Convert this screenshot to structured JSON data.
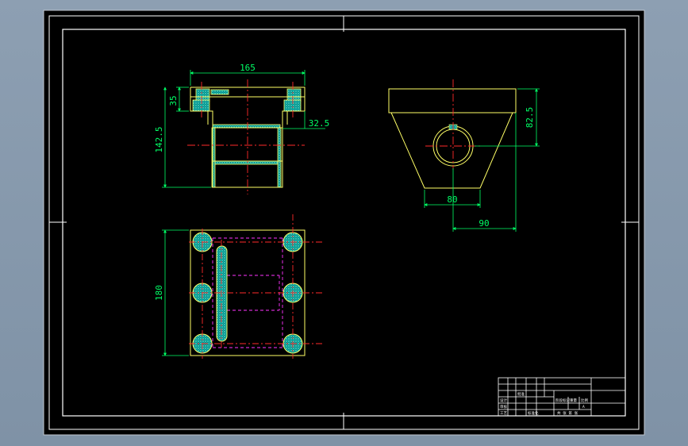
{
  "colors": {
    "background": "#8b9db0",
    "canvas": "#000000",
    "frame": "#ffffff",
    "outline": "#ffff66",
    "dimension": "#00ff66",
    "centerline": "#ff2a2a",
    "hidden_line": "#ff33ff",
    "hatch": "#00a8a8",
    "hatch_dot": "#66ffcc"
  },
  "dimensions": {
    "top_width": "165",
    "flange_height": "35",
    "step_depth": "32.5",
    "total_height": "142.5",
    "side_height": "82.5",
    "bottom_width": "80",
    "offset": "90",
    "plan_length": "180"
  },
  "title_block": {
    "label_1": "设计",
    "label_2": "审核",
    "label_3": "工艺",
    "label_4": "标准化",
    "label_5": "批准",
    "stage_mark": "阶段标记",
    "weight": "重量",
    "scale": "比例",
    "sheet": "共 张 第 张",
    "code_mark": "A"
  }
}
